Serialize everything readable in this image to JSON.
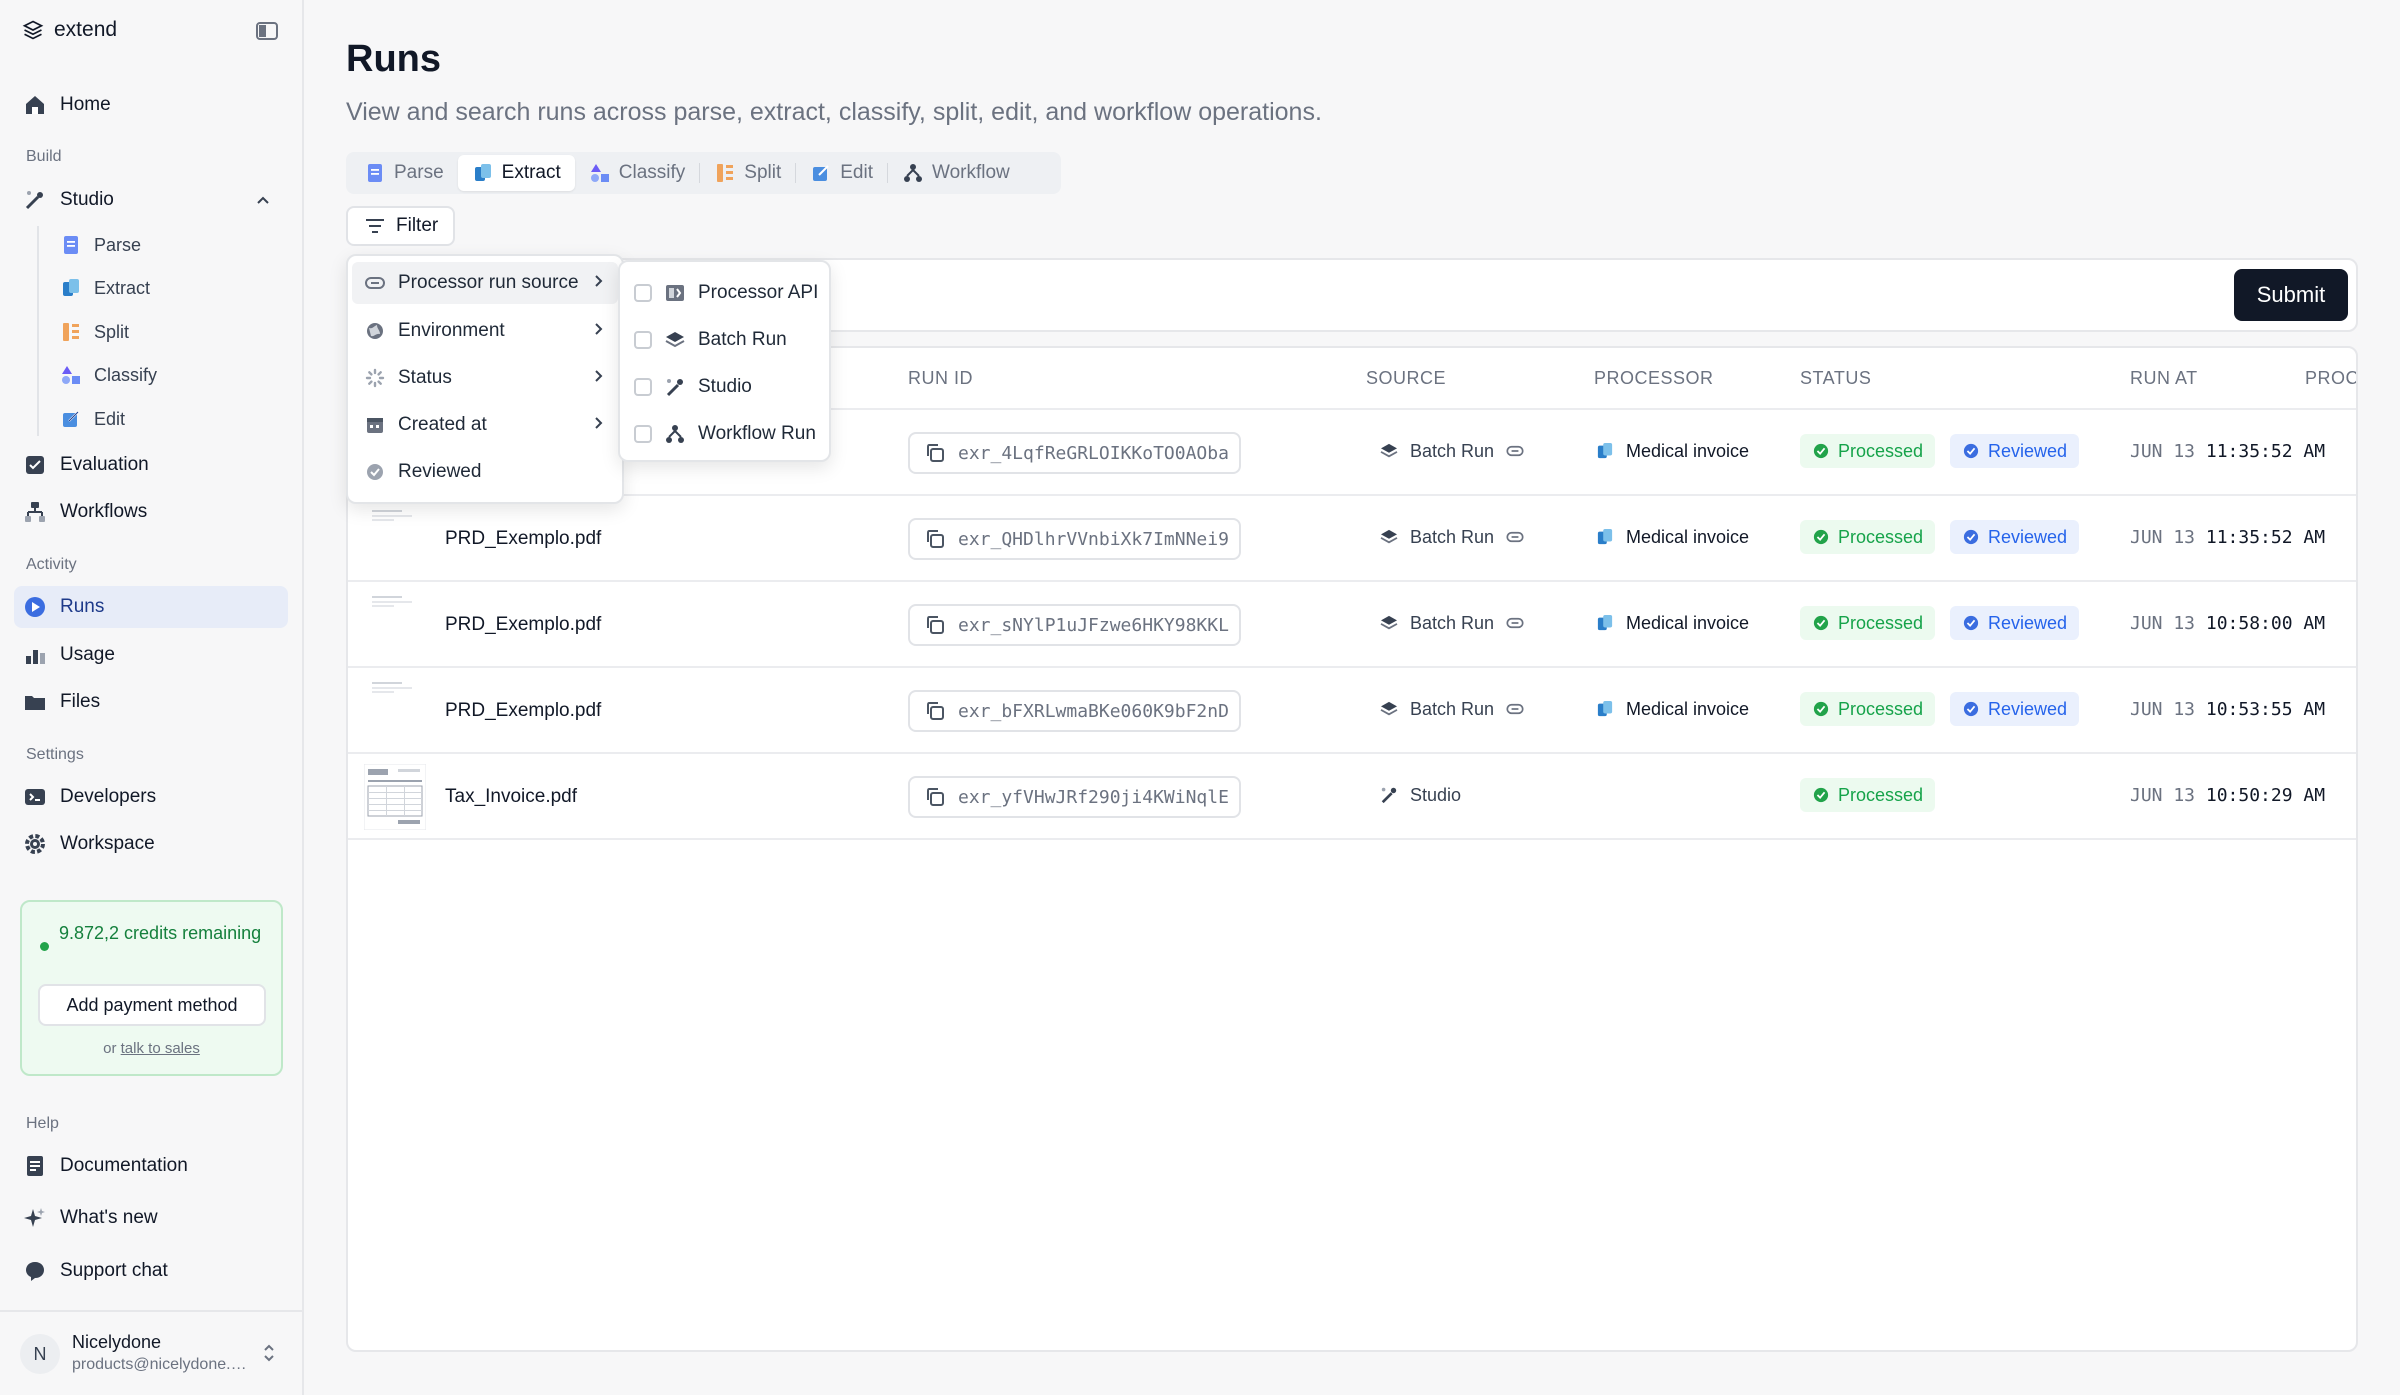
{
  "app": {
    "brand": "extend"
  },
  "sidebar": {
    "home": "Home",
    "build_label": "Build",
    "studio": "Studio",
    "studio_items": [
      "Parse",
      "Extract",
      "Split",
      "Classify",
      "Edit"
    ],
    "evaluation": "Evaluation",
    "workflows": "Workflows",
    "activity_label": "Activity",
    "runs": "Runs",
    "usage": "Usage",
    "files": "Files",
    "settings_label": "Settings",
    "developers": "Developers",
    "workspace": "Workspace",
    "credits_text": "9.872,2 credits remaining",
    "add_payment": "Add payment method",
    "or_text": "or",
    "talk_to_sales": "talk to sales",
    "help_label": "Help",
    "documentation": "Documentation",
    "whats_new": "What's new",
    "support_chat": "Support chat",
    "user": {
      "initial": "N",
      "name": "Nicelydone",
      "email": "products@nicelydone.club"
    }
  },
  "page": {
    "title": "Runs",
    "subtitle": "View and search runs across parse, extract, classify, split, edit, and workflow operations.",
    "tabs": [
      "Parse",
      "Extract",
      "Classify",
      "Split",
      "Edit",
      "Workflow"
    ],
    "active_tab": "Extract",
    "filter_label": "Filter",
    "submit_label": "Submit"
  },
  "filter_menu": {
    "items": [
      "Processor run source",
      "Environment",
      "Status",
      "Created at",
      "Reviewed"
    ],
    "submenu": [
      "Processor API",
      "Batch Run",
      "Studio",
      "Workflow Run"
    ]
  },
  "table": {
    "columns": [
      "RUN ID",
      "SOURCE",
      "PROCESSOR",
      "STATUS",
      "RUN AT",
      "PROCE"
    ],
    "rows": [
      {
        "file": "",
        "run_id": "exr_4LqfReGRLOIKKoTO0AOba",
        "source": "Batch Run",
        "processor": "Medical invoice",
        "status": "Processed",
        "reviewed": "Reviewed",
        "date": "JUN 13",
        "time": "11:35:52 AM"
      },
      {
        "file": "PRD_Exemplo.pdf",
        "run_id": "exr_QHDlhrVVnbiXk7ImNNei9",
        "source": "Batch Run",
        "processor": "Medical invoice",
        "status": "Processed",
        "reviewed": "Reviewed",
        "date": "JUN 13",
        "time": "11:35:52 AM"
      },
      {
        "file": "PRD_Exemplo.pdf",
        "run_id": "exr_sNYlP1uJFzwe6HKY98KKL",
        "source": "Batch Run",
        "processor": "Medical invoice",
        "status": "Processed",
        "reviewed": "Reviewed",
        "date": "JUN 13",
        "time": "10:58:00 AM"
      },
      {
        "file": "PRD_Exemplo.pdf",
        "run_id": "exr_bFXRLwmaBKe060K9bF2nD",
        "source": "Batch Run",
        "processor": "Medical invoice",
        "status": "Processed",
        "reviewed": "Reviewed",
        "date": "JUN 13",
        "time": "10:53:55 AM"
      },
      {
        "file": "Tax_Invoice.pdf",
        "run_id": "exr_yfVHwJRf290ji4KWiNqlE",
        "source": "Studio",
        "processor": "",
        "status": "Processed",
        "reviewed": "",
        "date": "JUN 13",
        "time": "10:50:29 AM"
      }
    ]
  },
  "colors": {
    "accent": "#2563eb",
    "success": "#16a34a",
    "dark": "#111827"
  }
}
